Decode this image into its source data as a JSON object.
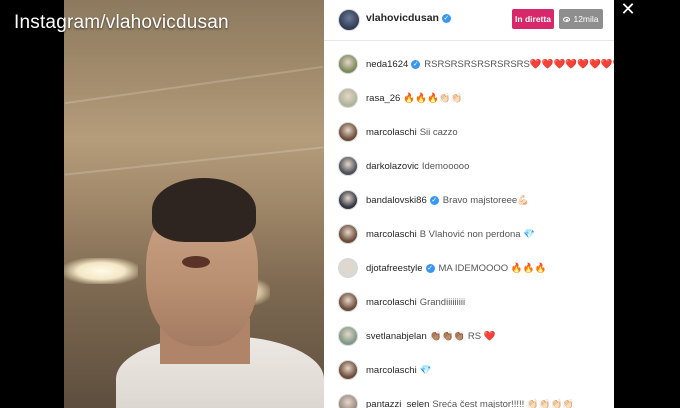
{
  "watermark": "Instagram/vlahovicdusan",
  "host": {
    "username": "vlahovicdusan"
  },
  "live_label": "In diretta",
  "viewers": "12mila",
  "comments": [
    {
      "user": "neda1624",
      "verified": true,
      "msg": "RSRSRSRSRSRSRSRS❤️❤️❤️❤️❤️❤️❤️❤️ RS",
      "avatar_color": "#7a8a5a"
    },
    {
      "user": "rasa_26",
      "verified": false,
      "msg": "🔥🔥🔥👏🏻👏🏻",
      "avatar_color": "#b0b39a"
    },
    {
      "user": "marcolaschi",
      "verified": false,
      "msg": "Sii cazzo",
      "avatar_color": "#6a4a38"
    },
    {
      "user": "darkolazovic",
      "verified": false,
      "msg": "Idemooooo",
      "avatar_color": "#4a4f58"
    },
    {
      "user": "bandalovski86",
      "verified": true,
      "msg": "Bravo majstoreee💪🏻",
      "avatar_color": "#2f3440"
    },
    {
      "user": "marcolaschi",
      "verified": false,
      "msg": "B Vlahović non perdona 💎",
      "avatar_color": "#6a4a38"
    },
    {
      "user": "djotafreestyle",
      "verified": true,
      "msg": "MA IDEMOOOO 🔥🔥🔥",
      "avatar_color": "#d8d8d8"
    },
    {
      "user": "marcolaschi",
      "verified": false,
      "msg": "Grandiiiiiiiii",
      "avatar_color": "#6a4a38"
    },
    {
      "user": "svetlanabjelan",
      "verified": false,
      "msg": "👏🏽👏🏽👏🏽 RS ❤️",
      "avatar_color": "#7d9a86"
    },
    {
      "user": "marcolaschi",
      "verified": false,
      "msg": "💎",
      "avatar_color": "#6a4a38"
    },
    {
      "user": "pantazzi_selen",
      "verified": false,
      "msg": "Sreća čest majstor!!!!! 👏🏻👏🏻👏🏻👏🏻",
      "avatar_color": "#9b8a80"
    }
  ]
}
